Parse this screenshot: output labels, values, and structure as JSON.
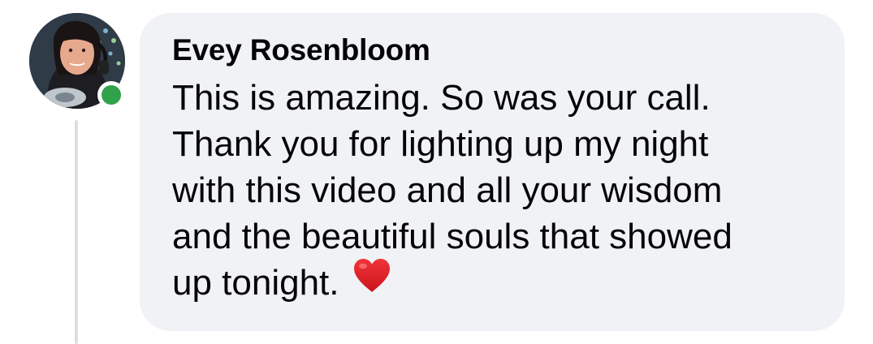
{
  "comment": {
    "author": "Evey Rosenbloom",
    "text": "This is amazing. So was your call.\nThank you for lighting up my night\nwith this video and all your wisdom\nand the beautiful souls that showed\nup tonight.",
    "emoji": "heart-icon",
    "online": true
  },
  "colors": {
    "bubble": "#f0f2f5",
    "text": "#050505",
    "online_dot": "#31a24c",
    "heart": "#e8202a",
    "thread_line": "#dcdee2"
  }
}
